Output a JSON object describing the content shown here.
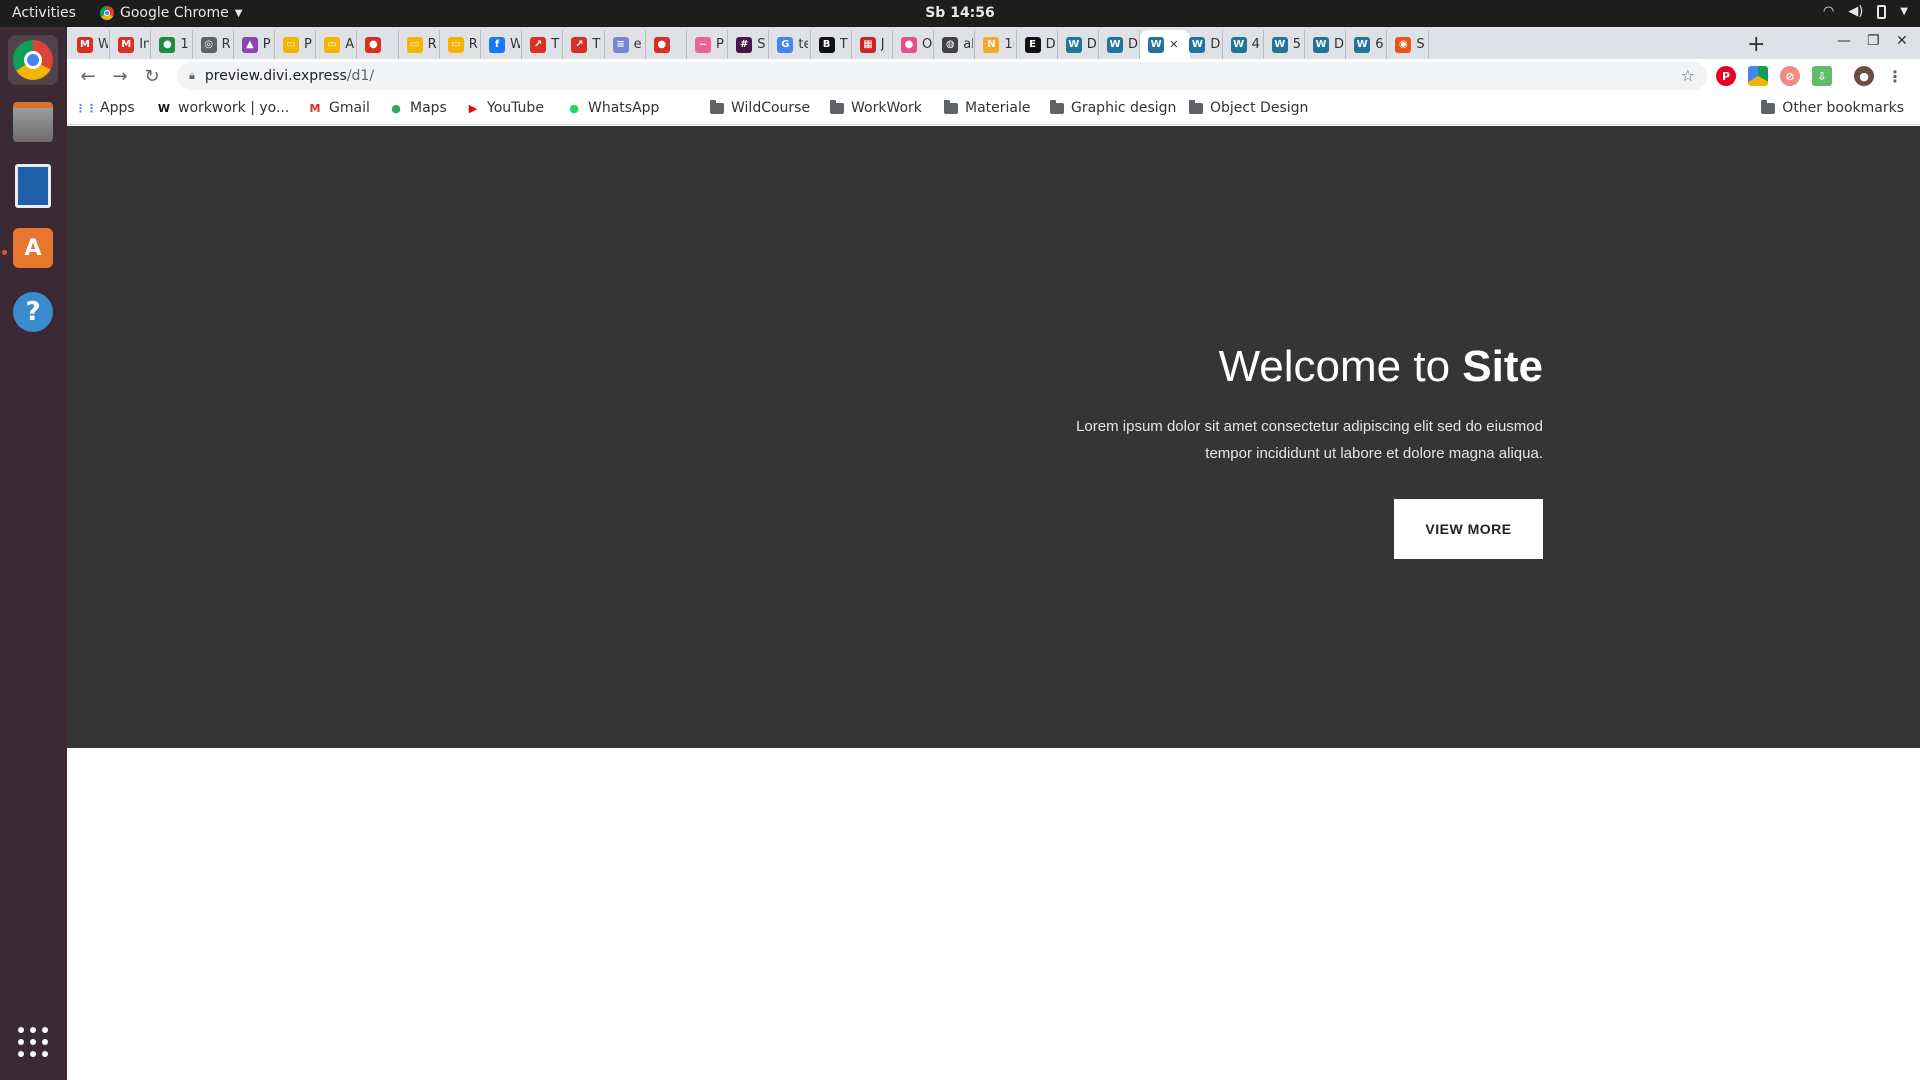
{
  "os": {
    "activities_label": "Activities",
    "app_menu_label": "Google Chrome",
    "clock": "Sb 14:56"
  },
  "browser": {
    "tabs": [
      {
        "short": "W",
        "icon": "gmail-icon",
        "color": "#d93025",
        "glyph": "M"
      },
      {
        "short": "In",
        "icon": "gmail-icon",
        "color": "#d93025",
        "glyph": "M"
      },
      {
        "short": "1:",
        "icon": "green-circle-icon",
        "color": "#1e8e3e",
        "glyph": "●"
      },
      {
        "short": "R",
        "icon": "gray-circle-icon",
        "color": "#5f6368",
        "glyph": "◎"
      },
      {
        "short": "P",
        "icon": "purple-profile-icon",
        "color": "#8e44ad",
        "glyph": "▲"
      },
      {
        "short": "P",
        "icon": "slides-icon",
        "color": "#f4b400",
        "glyph": "▭"
      },
      {
        "short": "A",
        "icon": "slides-icon",
        "color": "#f4b400",
        "glyph": "▭"
      },
      {
        "short": "",
        "icon": "record-icon",
        "color": "#d93025",
        "glyph": "●"
      },
      {
        "short": "R",
        "icon": "slides-icon",
        "color": "#f4b400",
        "glyph": "▭"
      },
      {
        "short": "R",
        "icon": "slides-icon",
        "color": "#f4b400",
        "glyph": "▭"
      },
      {
        "short": "W",
        "icon": "facebook-icon",
        "color": "#1877f2",
        "glyph": "f"
      },
      {
        "short": "T",
        "icon": "trending-icon",
        "color": "#d93025",
        "glyph": "↗"
      },
      {
        "short": "T",
        "icon": "trending-icon",
        "color": "#d93025",
        "glyph": "↗"
      },
      {
        "short": "e",
        "icon": "doc-icon",
        "color": "#7986cb",
        "glyph": "≡"
      },
      {
        "short": "",
        "icon": "record-icon",
        "color": "#d93025",
        "glyph": "●"
      },
      {
        "short": "P",
        "icon": "pink-logo-icon",
        "color": "#f06292",
        "glyph": "~"
      },
      {
        "short": "S",
        "icon": "slack-icon",
        "color": "#4a154b",
        "glyph": "#"
      },
      {
        "short": "te",
        "icon": "google-icon",
        "color": "#4285f4",
        "glyph": "G"
      },
      {
        "short": "T",
        "icon": "behance-icon",
        "color": "#111111",
        "glyph": "B"
      },
      {
        "short": "J",
        "icon": "grid-red-icon",
        "color": "#c62828",
        "glyph": "▦"
      },
      {
        "short": "O",
        "icon": "dribbble-icon",
        "color": "#ea4c89",
        "glyph": "●"
      },
      {
        "short": "al",
        "icon": "globe-icon",
        "color": "#424242",
        "glyph": "◍"
      },
      {
        "short": "1(",
        "icon": "yellow-logo-icon",
        "color": "#f9a825",
        "glyph": "N"
      },
      {
        "short": "D",
        "icon": "e-letter-icon",
        "color": "#111111",
        "glyph": "E"
      },
      {
        "short": "D",
        "icon": "wordpress-icon",
        "color": "#21759b",
        "glyph": "W"
      },
      {
        "short": "D",
        "icon": "wordpress-icon",
        "color": "#21759b",
        "glyph": "W"
      },
      {
        "short": "",
        "icon": "wordpress-icon",
        "color": "#21759b",
        "glyph": "W",
        "active": true
      },
      {
        "short": "D",
        "icon": "wordpress-icon",
        "color": "#21759b",
        "glyph": "W"
      },
      {
        "short": "4",
        "icon": "wordpress-icon",
        "color": "#21759b",
        "glyph": "W"
      },
      {
        "short": "5",
        "icon": "wordpress-icon",
        "color": "#21759b",
        "glyph": "W"
      },
      {
        "short": "D",
        "icon": "wordpress-icon",
        "color": "#21759b",
        "glyph": "W"
      },
      {
        "short": "6",
        "icon": "wordpress-icon",
        "color": "#21759b",
        "glyph": "W"
      },
      {
        "short": "S",
        "icon": "ubuntu-icon",
        "color": "#e95420",
        "glyph": "◉"
      }
    ],
    "url_host": "preview.divi.express",
    "url_path": "/d1/",
    "bookmarks": [
      {
        "label": "Apps",
        "icon": "apps-grid-icon"
      },
      {
        "label": "workwork | yo...",
        "icon": "workwork-icon"
      },
      {
        "label": "Gmail",
        "icon": "gmail-icon"
      },
      {
        "label": "Maps",
        "icon": "maps-icon"
      },
      {
        "label": "YouTube",
        "icon": "youtube-icon"
      },
      {
        "label": "WhatsApp",
        "icon": "whatsapp-icon"
      },
      {
        "label": "WildCourse",
        "icon": "folder-icon"
      },
      {
        "label": "WorkWork",
        "icon": "folder-icon"
      },
      {
        "label": "Materiale",
        "icon": "folder-icon"
      },
      {
        "label": "Graphic design",
        "icon": "folder-icon"
      },
      {
        "label": "Object Design",
        "icon": "folder-icon"
      }
    ],
    "other_bookmarks": "Other bookmarks"
  },
  "page": {
    "hero": {
      "title_light": "Welcome to",
      "title_bold": "Site",
      "text_line1": "Lorem ipsum dolor sit amet consectetur adipiscing elit sed do eiusmod",
      "text_line2": "tempor incididunt ut labore et dolore magna aliqua.",
      "button_label": "VIEW MORE"
    },
    "colors": {
      "hero_bg": "#353535",
      "button_bg": "#ffffff"
    }
  }
}
